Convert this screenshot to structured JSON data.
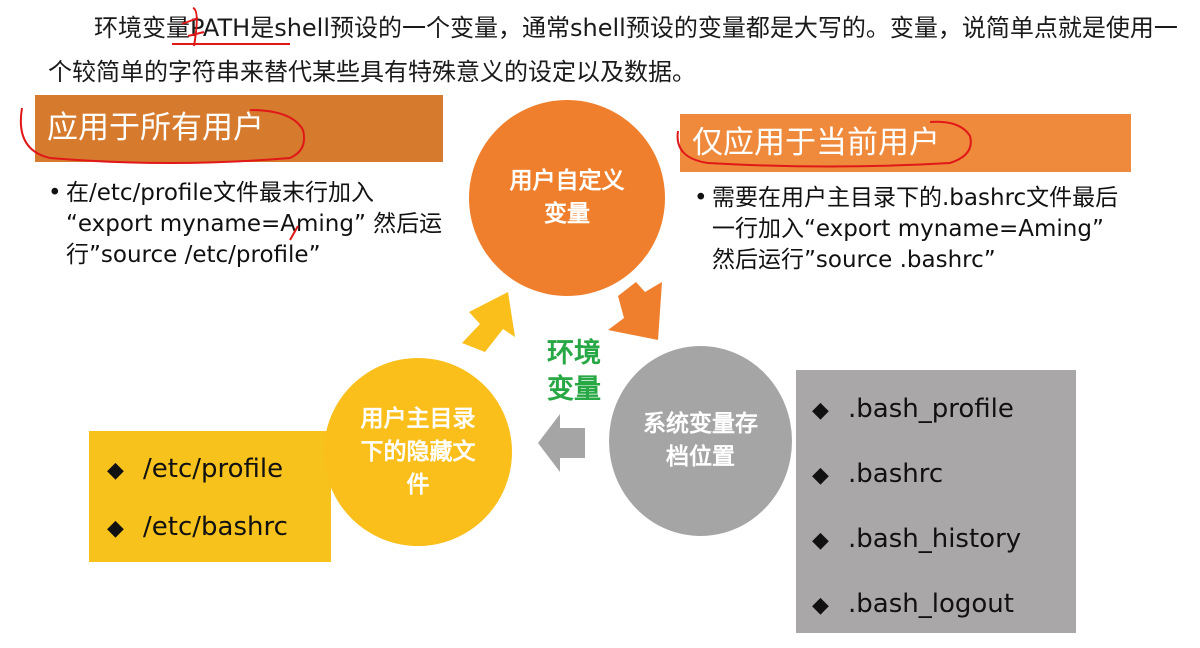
{
  "intro": {
    "text": "环境变量PATH是shell预设的一个变量，通常shell预设的变量都是大写的。变量，说简单点就是使用一个较简单的字符串来替代某些具有特殊意义的设定以及数据。"
  },
  "left_bar": {
    "title": "应用于所有用户"
  },
  "right_bar": {
    "title": "仅应用于当前用户"
  },
  "left_note": {
    "bullet": "•",
    "text": "在/etc/profile文件最末行加入 “export myname=Aming” 然后运行”source /etc/profile”"
  },
  "right_note": {
    "bullet": "•",
    "text": "需要在用户主目录下的.bashrc文件最后一行加入“export myname=Aming” 然后运行”source .bashrc”"
  },
  "center_label": "环境变量",
  "circles": {
    "top": "用户自定义变量",
    "left": "用户主目录下的隐藏文件",
    "right": "系统变量存档位置"
  },
  "yellow_box": {
    "items": [
      "/etc/profile",
      "/etc/bashrc"
    ]
  },
  "gray_box": {
    "items": [
      ".bash_profile",
      ".bashrc",
      ".bash_history",
      ".bash_logout"
    ]
  },
  "bullet_symbol": "◆",
  "colors": {
    "orange_dark": "#d67a2e",
    "orange": "#ef7f2c",
    "yellow": "#fbbf1c",
    "gray": "#a6a5a5",
    "green_label": "#28a745",
    "annotation_red": "#e01818"
  }
}
